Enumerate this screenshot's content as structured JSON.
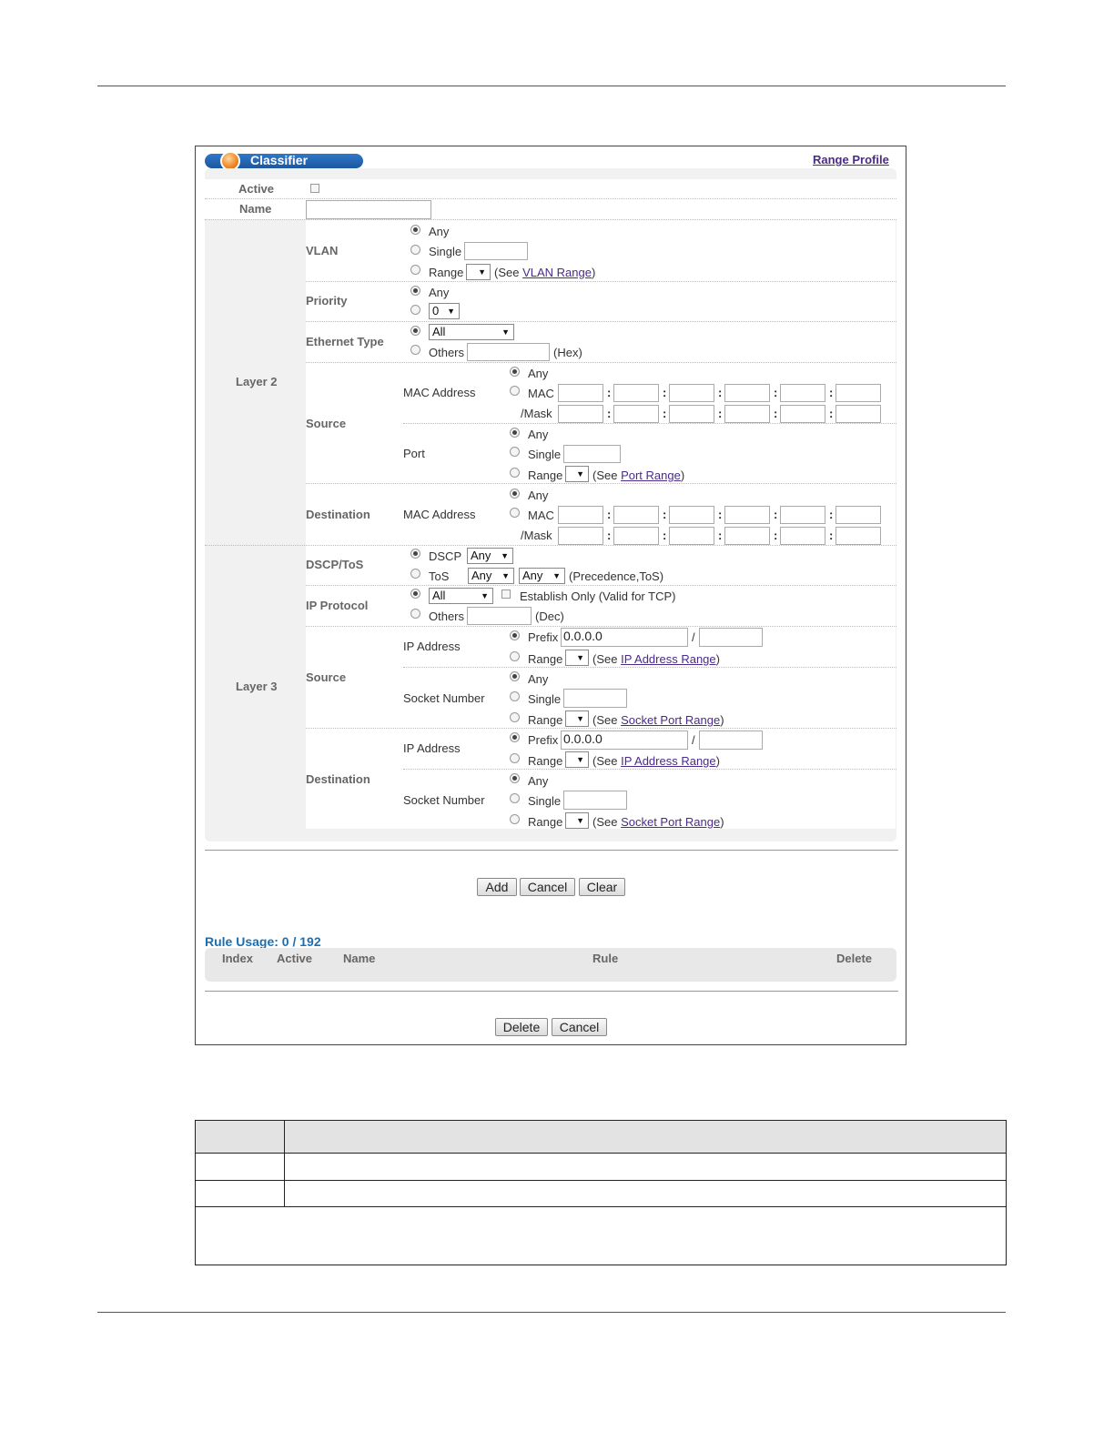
{
  "header": {
    "title": "Classifier",
    "range_profile": "Range Profile"
  },
  "fields": {
    "active": "Active",
    "name": "Name"
  },
  "sections": {
    "layer2": "Layer 2",
    "layer3": "Layer 3",
    "source": "Source",
    "destination": "Destination"
  },
  "vlan": {
    "label": "VLAN",
    "any": "Any",
    "single": "Single",
    "range": "Range",
    "see": "(See ",
    "see_link": "VLAN Range",
    "close": ")"
  },
  "priority": {
    "label": "Priority",
    "any": "Any",
    "value": "0"
  },
  "ethernet_type": {
    "label": "Ethernet Type",
    "value": "All",
    "others": "Others",
    "hex": "(Hex)"
  },
  "mac": {
    "label": "MAC Address",
    "any": "Any",
    "mac": "MAC",
    "mask": "/Mask",
    "colon": ":"
  },
  "port": {
    "label": "Port",
    "any": "Any",
    "single": "Single",
    "range": "Range",
    "see": "(See ",
    "see_link": "Port Range",
    "close": ")"
  },
  "dscp_tos": {
    "label": "DSCP/ToS",
    "dscp": "DSCP",
    "dscp_value": "Any",
    "tos": "ToS",
    "tos_value1": "Any",
    "tos_value2": "Any",
    "note": "(Precedence,ToS)"
  },
  "ip_protocol": {
    "label": "IP Protocol",
    "value": "All",
    "establish": "Establish Only (Valid for TCP)",
    "others": "Others",
    "dec": "(Dec)"
  },
  "ip": {
    "label": "IP Address",
    "prefix": "Prefix",
    "prefix_value": "0.0.0.0",
    "slash": "/",
    "range": "Range",
    "see": "(See ",
    "see_link": "IP Address Range",
    "close": ")"
  },
  "socket": {
    "label": "Socket Number",
    "any": "Any",
    "single": "Single",
    "range": "Range",
    "see": "(See ",
    "see_link": "Socket Port Range",
    "close": ")"
  },
  "buttons": {
    "add": "Add",
    "cancel": "Cancel",
    "clear": "Clear",
    "delete": "Delete",
    "cancel2": "Cancel"
  },
  "rule_usage": "Rule Usage: 0 / 192",
  "table": {
    "index": "Index",
    "active": "Active",
    "name": "Name",
    "rule": "Rule",
    "delete": "Delete"
  },
  "arrow": "▼",
  "colors": {
    "title_bar": "#1f5fa8",
    "section_bg": "#f1f1f1",
    "link": "#4a2a8a",
    "rule_usage": "#1a6fb3"
  }
}
